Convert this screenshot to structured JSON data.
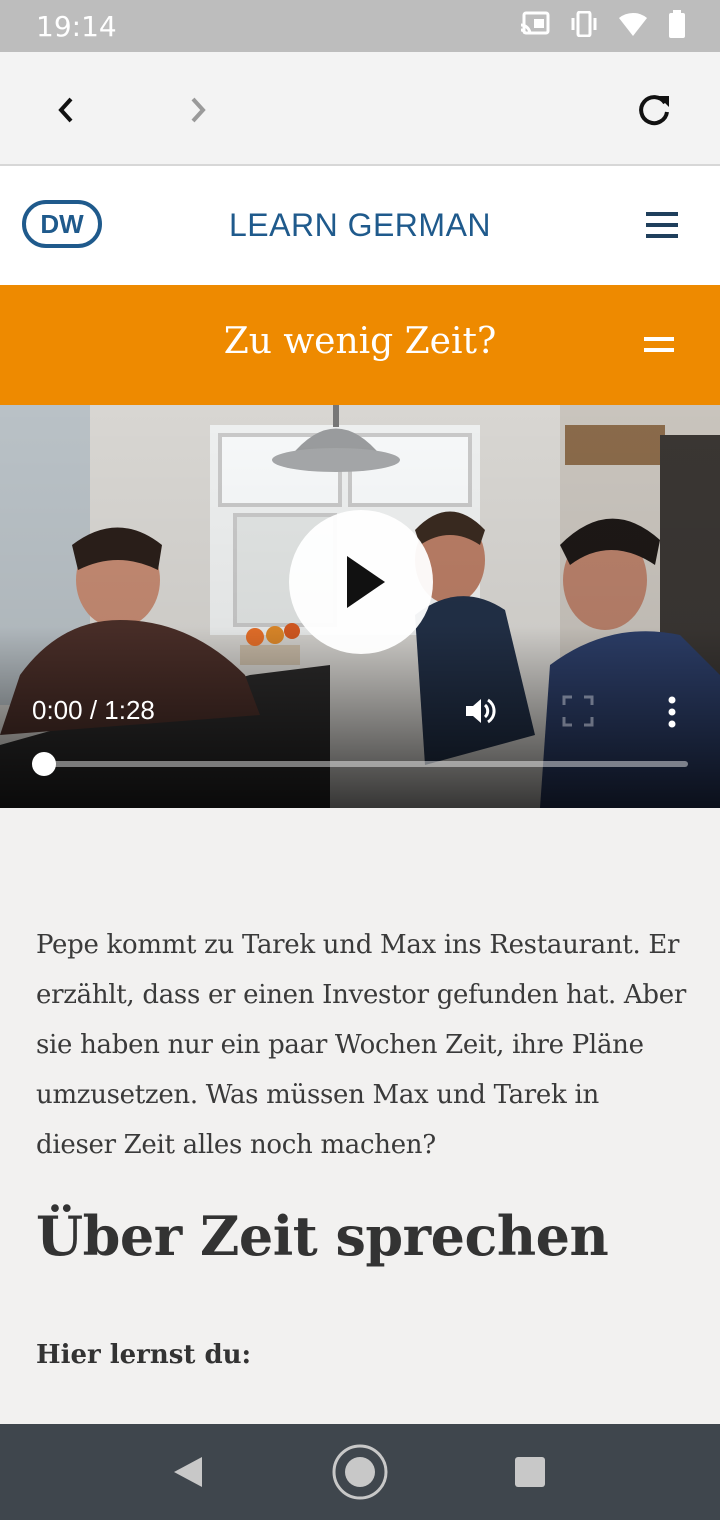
{
  "status_bar": {
    "time": "19:14",
    "icons": [
      "cast-icon",
      "vibrate-icon",
      "wifi-icon",
      "battery-icon"
    ]
  },
  "browser": {
    "back_icon": "chevron-left-icon",
    "forward_icon": "chevron-right-icon",
    "reload_icon": "reload-icon"
  },
  "site_header": {
    "logo_text": "DW",
    "title": "LEARN GERMAN",
    "menu_icon": "hamburger-icon"
  },
  "lesson_banner": {
    "title": "Zu wenig Zeit?",
    "menu_icon": "equals-menu-icon"
  },
  "video": {
    "timecode": "0:00 / 1:28",
    "progress": 0,
    "play_icon": "play-icon",
    "volume_icon": "volume-icon",
    "fullscreen_icon": "fullscreen-icon",
    "more_icon": "more-vertical-icon"
  },
  "article": {
    "intro": "Pepe kommt zu Tarek und Max ins Restaurant. Er erzählt, dass er einen Investor gefunden hat. Aber sie haben nur ein paar Wochen Zeit, ihre Pläne umzusetzen. Was müssen Max und Tarek in dieser Zeit alles noch machen?",
    "heading": "Über Zeit sprechen",
    "subheading": "Hier lernst du:"
  },
  "system_nav": {
    "back_icon": "triangle-back-icon",
    "home_icon": "circle-home-icon",
    "recents_icon": "square-recents-icon"
  },
  "colors": {
    "banner_orange": "#ee8a00",
    "dw_blue": "#1f5a8c",
    "nav_dark": "#3f464d"
  }
}
